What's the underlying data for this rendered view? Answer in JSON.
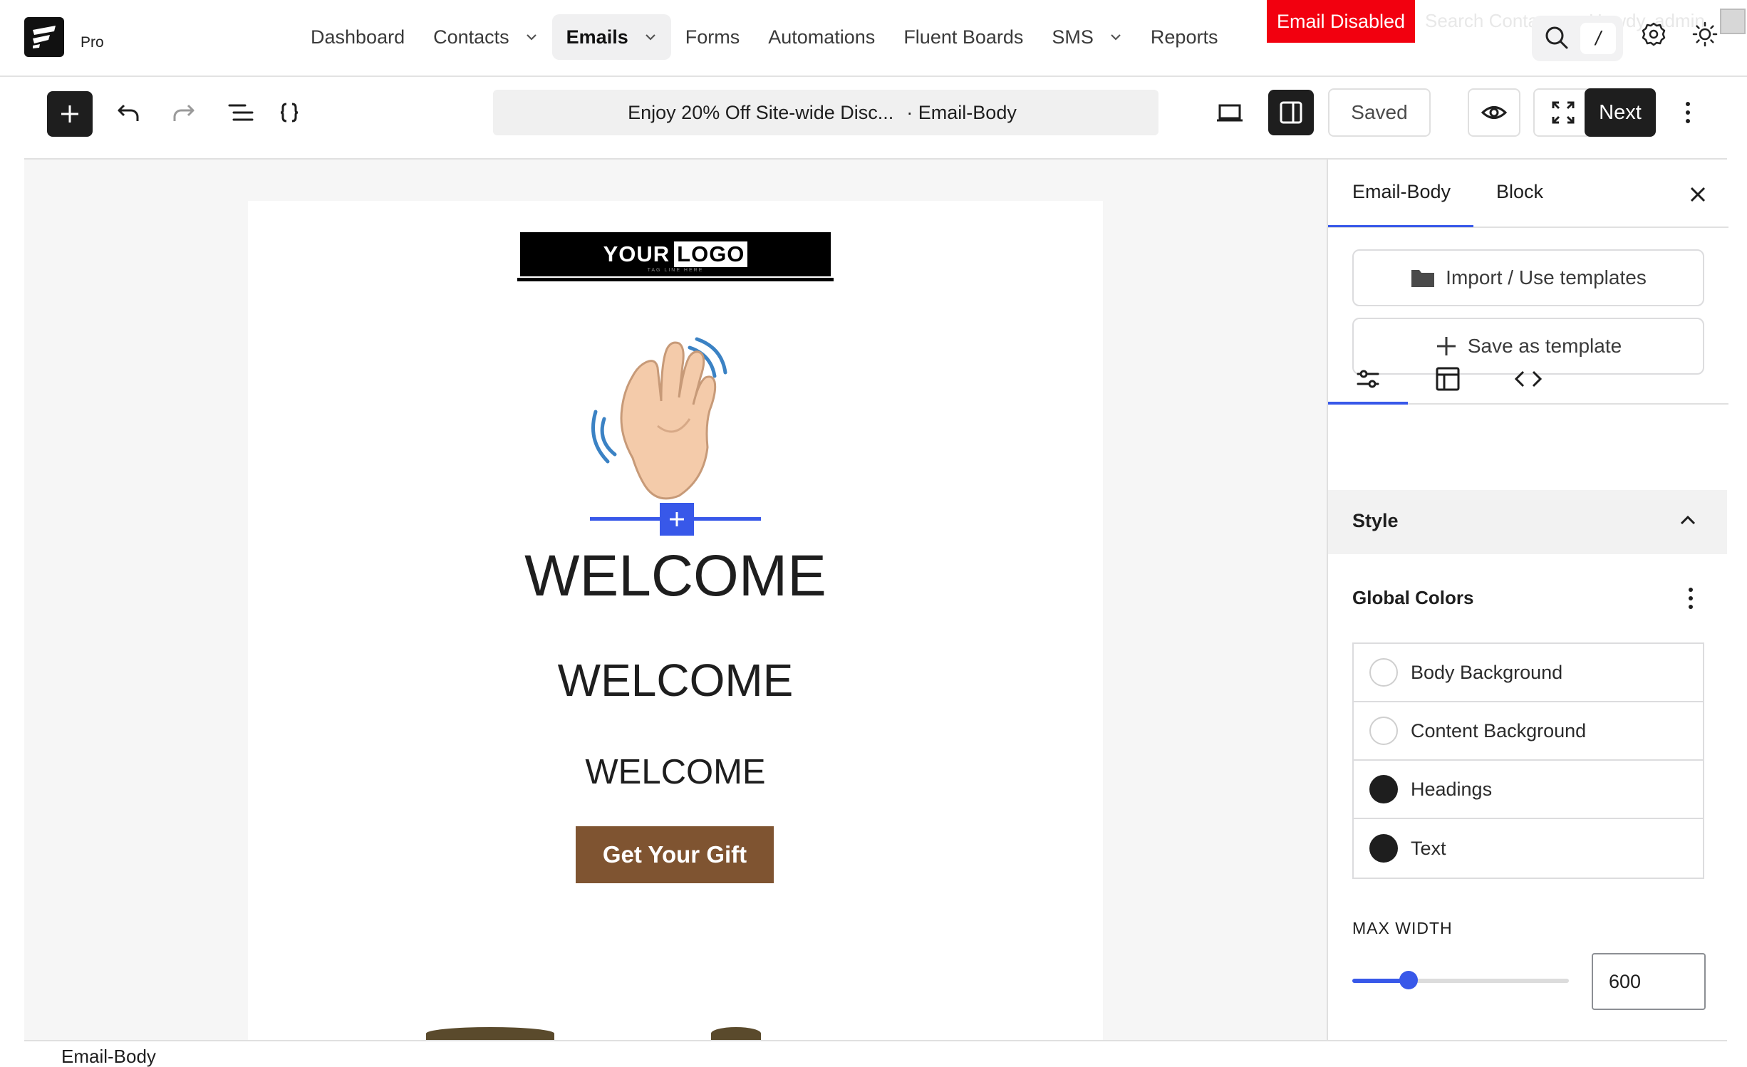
{
  "brand": {
    "plan": "Pro"
  },
  "nav": {
    "items": [
      {
        "label": "Dashboard",
        "dropdown": false,
        "active": false
      },
      {
        "label": "Contacts",
        "dropdown": true,
        "active": false
      },
      {
        "label": "Emails",
        "dropdown": true,
        "active": true
      },
      {
        "label": "Forms",
        "dropdown": false,
        "active": false
      },
      {
        "label": "Automations",
        "dropdown": false,
        "active": false
      },
      {
        "label": "Fluent Boards",
        "dropdown": false,
        "active": false
      },
      {
        "label": "SMS",
        "dropdown": true,
        "active": false
      },
      {
        "label": "Reports",
        "dropdown": false,
        "active": false
      }
    ],
    "email_disabled_label": "Email Disabled",
    "ghost_search_text": "Search Conta",
    "ghost_howdy_text": "Howdy, admin",
    "search_shortcut": "/"
  },
  "toolbar": {
    "doc_title": "Enjoy 20% Off Site-wide Disc...",
    "doc_context": "· Email-Body",
    "saved_label": "Saved",
    "next_label": "Next"
  },
  "email": {
    "logo_text_a": "YOUR",
    "logo_text_b": "LOGO",
    "logo_tagline": "TAG LINE HERE",
    "heading_1": "WELCOME",
    "heading_2": "WELCOME",
    "heading_3": "WELCOME",
    "button_label": "Get Your Gift",
    "button_color": "#7f5431"
  },
  "sidebar": {
    "tab_email_body": "Email-Body",
    "tab_block": "Block",
    "import_label": "Import / Use templates",
    "save_template_label": "Save as template",
    "style_section_title": "Style",
    "global_colors_title": "Global Colors",
    "colors": [
      {
        "label": "Body Background",
        "color": "#ffffff"
      },
      {
        "label": "Content Background",
        "color": "#ffffff"
      },
      {
        "label": "Headings",
        "color": "#1e1e1e"
      },
      {
        "label": "Text",
        "color": "#1e1e1e"
      }
    ],
    "max_width_label": "MAX WIDTH",
    "max_width_value": "600",
    "max_width_slider_fraction": 0.26
  },
  "footer": {
    "breadcrumb": "Email-Body"
  },
  "colors": {
    "accent": "#3858e9",
    "dark": "#1e1e1e",
    "alert": "#f2000f"
  }
}
